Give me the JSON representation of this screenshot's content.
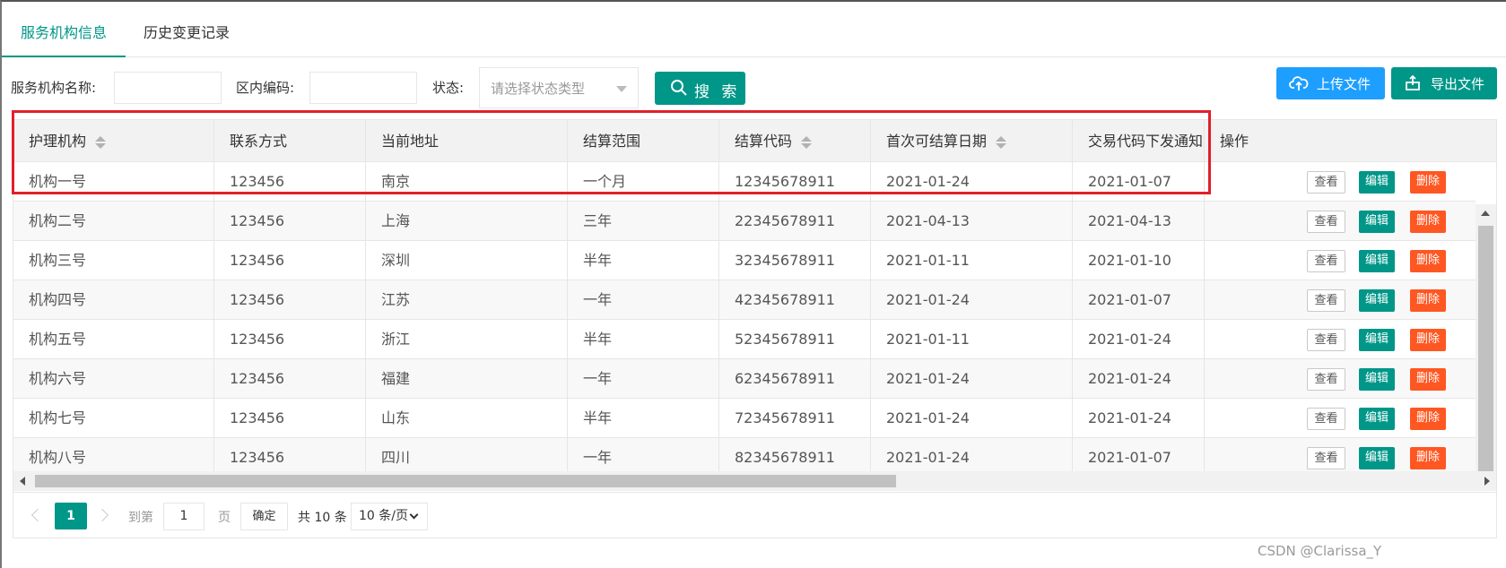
{
  "tabs": [
    {
      "label": "服务机构信息"
    },
    {
      "label": "历史变更记录"
    }
  ],
  "filters": {
    "name_label": "服务机构名称:",
    "code_label": "区内编码:",
    "status_label": "状态:",
    "status_placeholder": "请选择状态类型",
    "search_label": "搜 索"
  },
  "actions": {
    "upload_label": "上传文件",
    "export_label": "导出文件"
  },
  "table": {
    "headers": [
      "护理机构",
      "联系方式",
      "当前地址",
      "结算范围",
      "结算代码",
      "首次可结算日期",
      "交易代码下发通知",
      "操作"
    ],
    "rows": [
      [
        "机构一号",
        "123456",
        "南京",
        "一个月",
        "12345678911",
        "2021-01-24",
        "2021-01-07"
      ],
      [
        "机构二号",
        "123456",
        "上海",
        "三年",
        "22345678911",
        "2021-04-13",
        "2021-04-13"
      ],
      [
        "机构三号",
        "123456",
        "深圳",
        "半年",
        "32345678911",
        "2021-01-11",
        "2021-01-10"
      ],
      [
        "机构四号",
        "123456",
        "江苏",
        "一年",
        "42345678911",
        "2021-01-24",
        "2021-01-07"
      ],
      [
        "机构五号",
        "123456",
        "浙江",
        "半年",
        "52345678911",
        "2021-01-11",
        "2021-01-24"
      ],
      [
        "机构六号",
        "123456",
        "福建",
        "一年",
        "62345678911",
        "2021-01-24",
        "2021-01-24"
      ],
      [
        "机构七号",
        "123456",
        "山东",
        "半年",
        "72345678911",
        "2021-01-24",
        "2021-01-24"
      ],
      [
        "机构八号",
        "123456",
        "四川",
        "一年",
        "82345678911",
        "2021-01-24",
        "2021-01-07"
      ]
    ],
    "op_view": "查看",
    "op_edit": "编辑",
    "op_delete": "删除"
  },
  "pagination": {
    "current_page": "1",
    "goto_label": "到第",
    "goto_value": "1",
    "page_label": "页",
    "confirm_label": "确定",
    "total_label": "共 10 条",
    "page_size": "10 条/页"
  },
  "watermark": "CSDN @Clarissa_Y",
  "colors": {
    "primary": "#009688",
    "upload": "#1E9FFF",
    "danger": "#FF5722",
    "highlight": "#e0202a"
  }
}
